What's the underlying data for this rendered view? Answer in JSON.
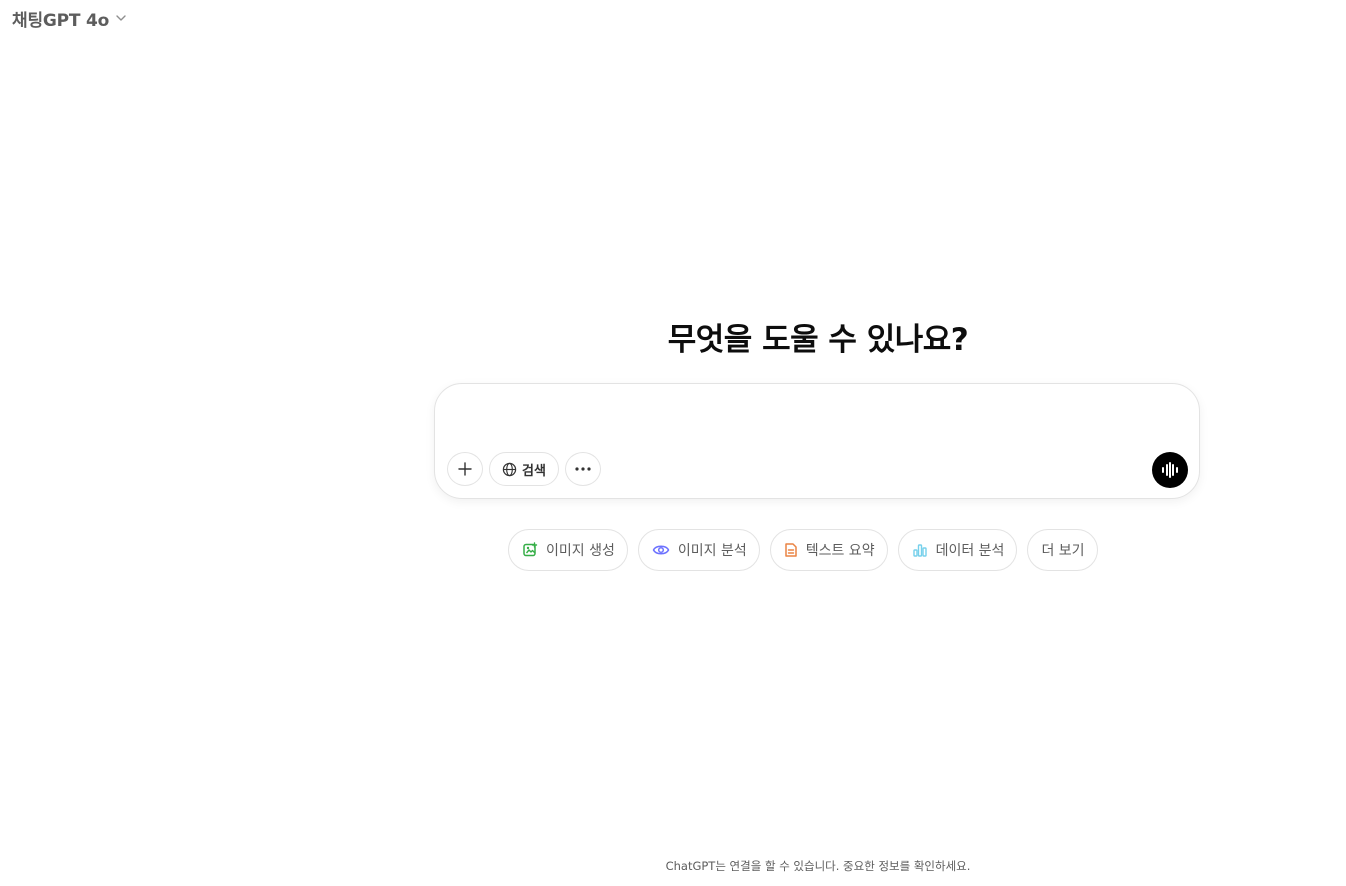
{
  "header": {
    "model_title": "채팅GPT 4o",
    "icons": {
      "dropdown": "chevron-down-icon"
    }
  },
  "main": {
    "headline": "무엇을 도울 수 있나요?"
  },
  "composer": {
    "placeholder": "",
    "buttons": {
      "attach_icon": "plus-icon",
      "search_label": "검색",
      "search_icon": "globe-icon",
      "more_icon": "more-icon",
      "voice_icon": "voice-mode-icon"
    }
  },
  "suggestions": [
    {
      "label": "이미지 생성",
      "icon": "image-create-icon",
      "color": "#35ae47"
    },
    {
      "label": "이미지 분석",
      "icon": "eye-icon",
      "color": "#6c71ff"
    },
    {
      "label": "텍스트 요약",
      "icon": "document-icon",
      "color": "#ea8444"
    },
    {
      "label": "데이터 분석",
      "icon": "chart-icon",
      "color": "#76d0eb"
    },
    {
      "label": "더 보기",
      "icon": "",
      "color": ""
    }
  ],
  "footer": {
    "disclaimer": "ChatGPT는 연결을 할 수 있습니다. 중요한 정보를 확인하세요."
  }
}
